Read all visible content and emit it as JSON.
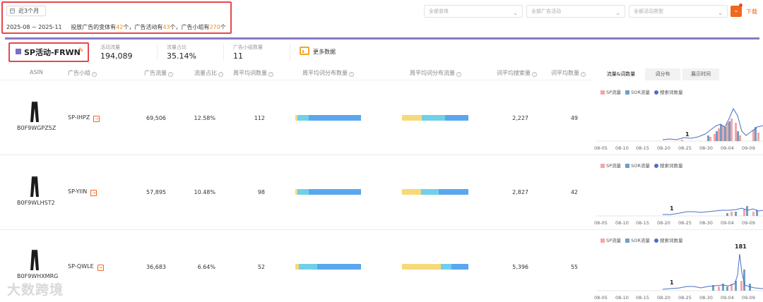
{
  "filters": {
    "date_range_label": "近3个月",
    "date_span": "2025-08 ~ 2025-11",
    "summary": {
      "prefix": "投放广告的变体有",
      "variants": "42",
      "mid1": "个，广告活动有",
      "campaigns": "43",
      "mid2": "个，广告小组有",
      "groups": "270",
      "suffix": "个"
    },
    "select_entity": "全部变体",
    "select_campaign": "全部广告活动",
    "select_type": "全部活动类型",
    "download_label": "下载"
  },
  "campaign": {
    "name": "SP活动-FRWN",
    "metrics": [
      {
        "label": "活动流量",
        "value": "194,089"
      },
      {
        "label": "流量占比",
        "value": "35.14%"
      },
      {
        "label": "广告小组数量",
        "value": "11"
      }
    ],
    "more_label": "更多数据"
  },
  "table": {
    "headers": {
      "asin": "ASIN",
      "group": "广告小组",
      "traffic": "广告流量",
      "share": "流量占比",
      "weekly_kw": "周平均词数量",
      "kw_dist": "周平均词分布数量",
      "traffic_dist": "周平均词分布流量",
      "avg_search": "词平均搜索量",
      "avg_kw": "词平均数量"
    },
    "tabs": [
      "流量&词数量",
      "词分布",
      "展示时间"
    ],
    "rows": [
      {
        "asin": "B0F9WGPZ5Z",
        "group": "SP-IHPZ",
        "traffic": "69,506",
        "share": "12.58%",
        "weekly_kw": "112",
        "avg_search": "2,227",
        "avg_kw": "49",
        "kw_dist": [
          0.03,
          0.17,
          0.8
        ],
        "traffic_dist": [
          0.3,
          0.35,
          0.35
        ]
      },
      {
        "asin": "B0F9WLHST2",
        "group": "SP-YIIN",
        "traffic": "57,895",
        "share": "10.48%",
        "weekly_kw": "98",
        "avg_search": "2,827",
        "avg_kw": "42",
        "kw_dist": [
          0.03,
          0.17,
          0.8
        ],
        "traffic_dist": [
          0.29,
          0.26,
          0.45
        ]
      },
      {
        "asin": "B0F9WHXMRG",
        "group": "SP-QWLE",
        "traffic": "36,683",
        "share": "6.64%",
        "weekly_kw": "52",
        "avg_search": "5,396",
        "avg_kw": "55",
        "kw_dist": [
          0.05,
          0.28,
          0.67
        ],
        "traffic_dist": [
          0.58,
          0.17,
          0.25
        ]
      }
    ]
  },
  "legend": {
    "sp": "SP流量",
    "sor": "SOR流量",
    "kw": "搜索词数量"
  },
  "colors": {
    "sp": "#f4a6a6",
    "sor": "#6f9fc6",
    "kw": "#4a6fc4",
    "accent": "#f0681e",
    "kw_seg1": "#f7d97a",
    "kw_seg2": "#6fd0e8",
    "kw_seg3": "#5aa7ee"
  },
  "chart_data": [
    {
      "type": "bar",
      "x": [
        "08-05",
        "08-10",
        "08-15",
        "08-20",
        "08-25",
        "08-30",
        "09-04",
        "09-09"
      ],
      "annotation": "1",
      "series": [
        {
          "name": "SP流量"
        },
        {
          "name": "SOR流量"
        },
        {
          "name": "搜索词数量"
        }
      ]
    },
    {
      "type": "bar",
      "x": [
        "08-05",
        "08-10",
        "08-15",
        "08-20",
        "08-25",
        "08-30",
        "09-04",
        "09-09"
      ],
      "annotation": "1",
      "series": [
        {
          "name": "SP流量"
        },
        {
          "name": "SOR流量"
        },
        {
          "name": "搜索词数量"
        }
      ]
    },
    {
      "type": "bar",
      "x": [
        "08-05",
        "08-10",
        "08-15",
        "08-20",
        "08-25",
        "08-30",
        "09-04",
        "09-09"
      ],
      "annotation": "1",
      "peak_label": "181",
      "series": [
        {
          "name": "SP流量"
        },
        {
          "name": "SOR流量"
        },
        {
          "name": "搜索词数量"
        }
      ]
    }
  ],
  "watermark": "大数跨境"
}
